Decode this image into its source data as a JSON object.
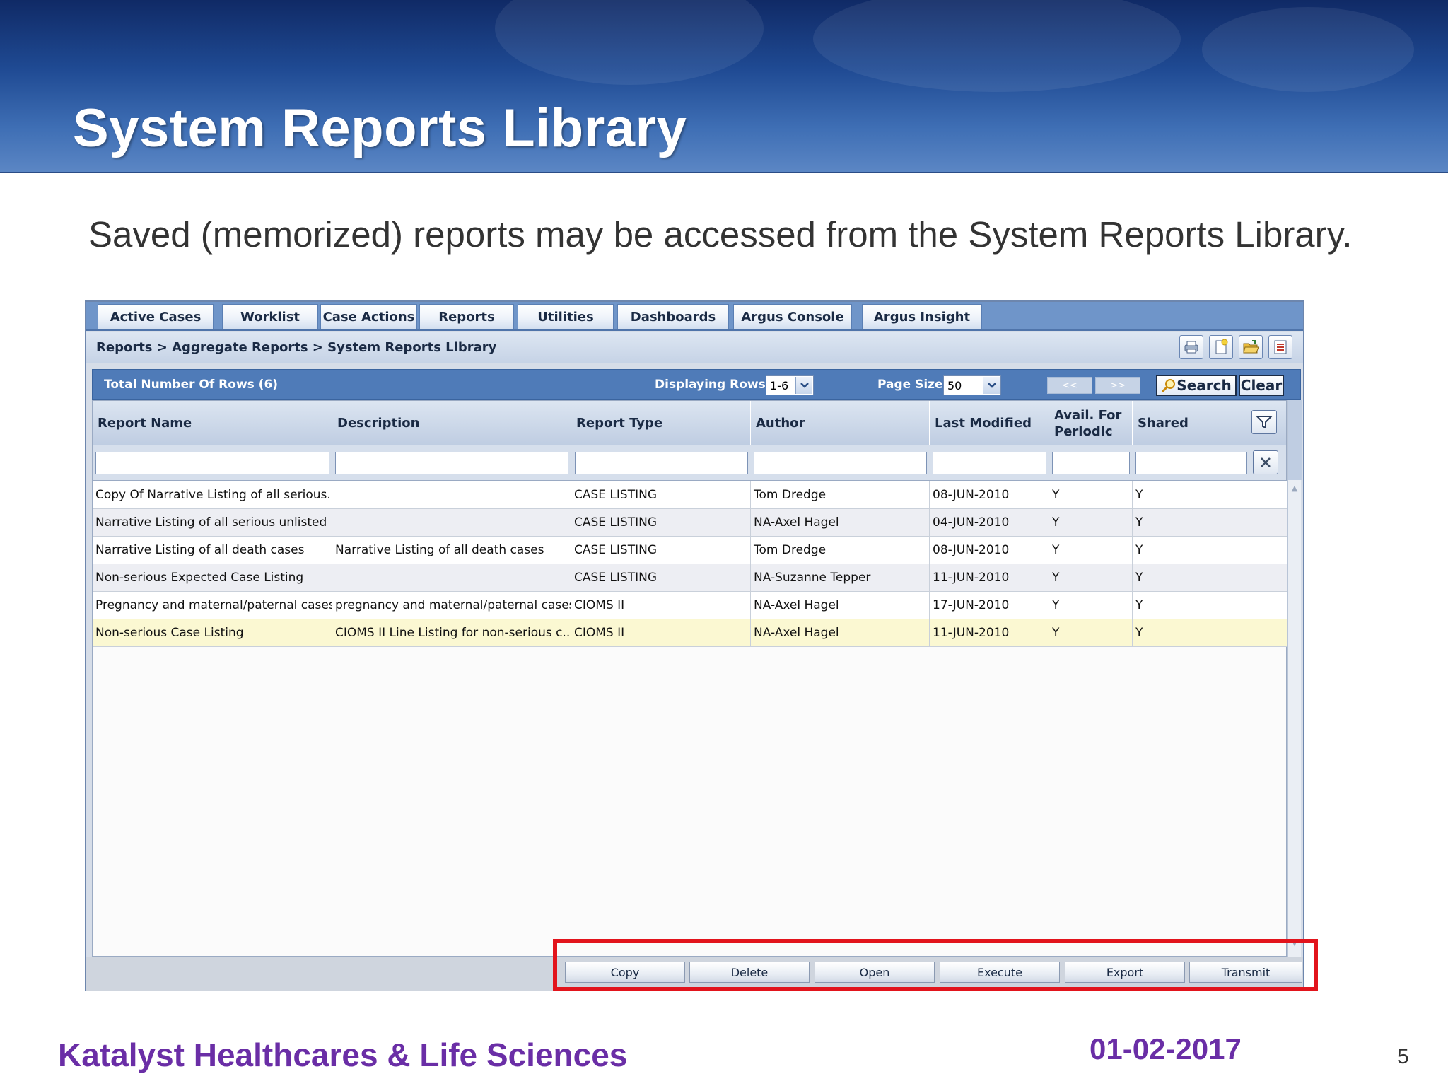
{
  "slide": {
    "title": "System Reports Library",
    "subtitle": "Saved (memorized) reports may be accessed from the System Reports Library.",
    "company": "Katalyst Healthcares & Life Sciences",
    "date": "01-02-2017",
    "page_number": "5"
  },
  "app": {
    "tabs": [
      "Active Cases",
      "Worklist",
      "Case Actions",
      "Reports",
      "Utilities",
      "Dashboards",
      "Argus Console",
      "Argus Insight"
    ],
    "breadcrumb": "Reports > Aggregate Reports > System Reports Library",
    "toolbar_icons": [
      "print-icon",
      "new-report-icon",
      "open-folder-icon",
      "list-icon"
    ],
    "rows_bar": {
      "total_label": "Total Number Of Rows (6)",
      "displaying_label": "Displaying Rows",
      "displaying_value": "1-6",
      "page_size_label": "Page Size",
      "page_size_value": "50",
      "prev_label": "<<",
      "next_label": ">>",
      "search_label": "Search",
      "clear_label": "Clear"
    },
    "columns": [
      "Report Name",
      "Description",
      "Report Type",
      "Author",
      "Last Modified",
      "Avail. For Periodic",
      "Shared"
    ],
    "rows": [
      [
        "Copy Of Narrative Listing of all serious...",
        "",
        "CASE LISTING",
        "Tom Dredge",
        "08-JUN-2010",
        "Y",
        "Y"
      ],
      [
        "Narrative Listing of all serious unlisted ...",
        "",
        "CASE LISTING",
        "NA-Axel Hagel",
        "04-JUN-2010",
        "Y",
        "Y"
      ],
      [
        "Narrative Listing of all death cases",
        "Narrative Listing of all death cases",
        "CASE LISTING",
        "Tom Dredge",
        "08-JUN-2010",
        "Y",
        "Y"
      ],
      [
        "Non-serious Expected Case Listing",
        "",
        "CASE LISTING",
        "NA-Suzanne Tepper",
        "11-JUN-2010",
        "Y",
        "Y"
      ],
      [
        "Pregnancy and maternal/paternal cases",
        "pregnancy and maternal/paternal cases",
        "CIOMS II",
        "NA-Axel Hagel",
        "17-JUN-2010",
        "Y",
        "Y"
      ],
      [
        "Non-serious Case Listing",
        "CIOMS II Line Listing for non-serious c...",
        "CIOMS II",
        "NA-Axel Hagel",
        "11-JUN-2010",
        "Y",
        "Y"
      ]
    ],
    "selected_row": 5,
    "actions": [
      "Copy",
      "Delete",
      "Open",
      "Execute",
      "Export",
      "Transmit"
    ],
    "colors": {
      "tabbar": "#6f95c9",
      "rows_bar": "#4f7bb8",
      "selected_row": "#fbf8d2",
      "highlight": "#e2141c",
      "company_text": "#6a2ea6"
    }
  }
}
